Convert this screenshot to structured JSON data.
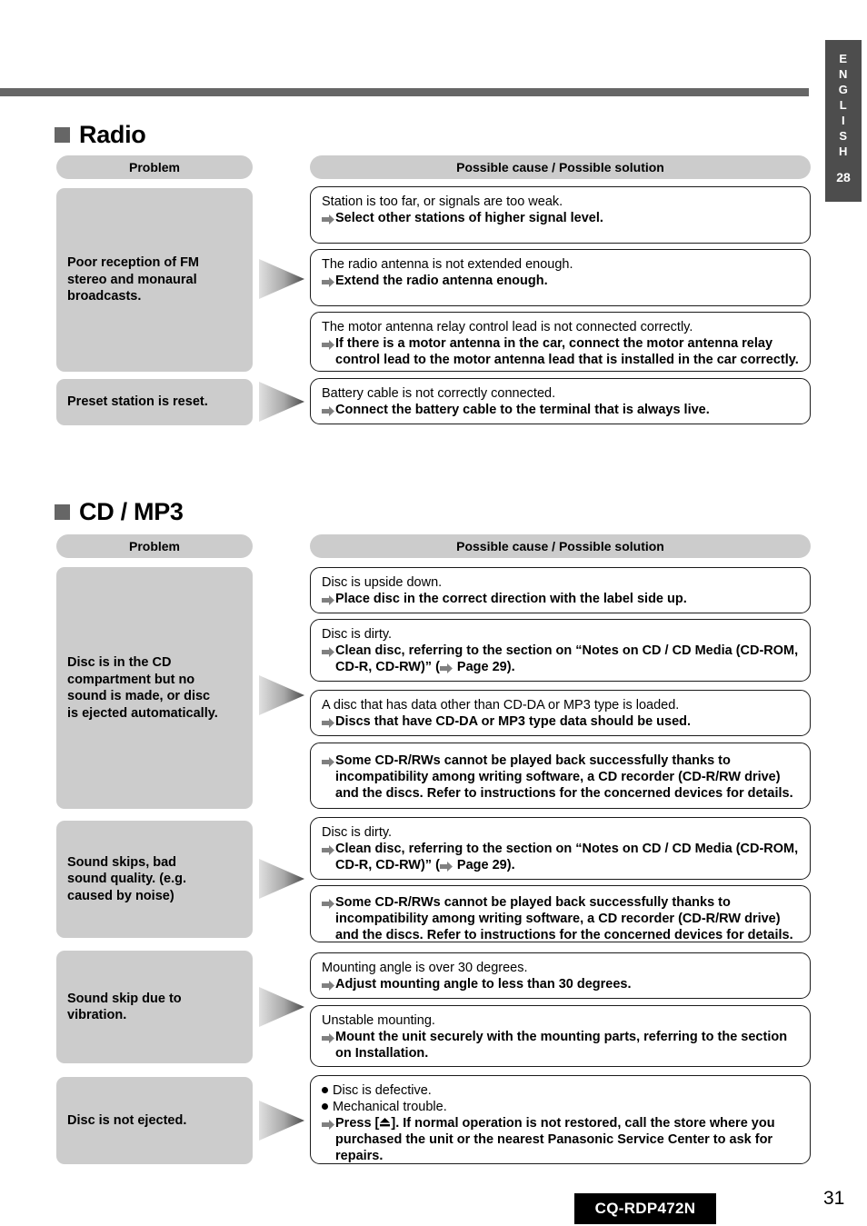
{
  "side_tab": {
    "language_letters": [
      "E",
      "N",
      "G",
      "L",
      "I",
      "S",
      "H"
    ],
    "number": "28"
  },
  "footer": {
    "model": "CQ-RDP472N",
    "page_number": "31"
  },
  "column_headers": {
    "problem": "Problem",
    "cause_solution": "Possible cause / Possible solution"
  },
  "sections": [
    {
      "title": "Radio",
      "rows": [
        {
          "problem": "Poor reception of FM stereo and monaural broadcasts.",
          "items": [
            {
              "cause": "Station is too far, or signals are too weak.",
              "solution": "Select other stations of higher signal level."
            },
            {
              "cause": "The radio antenna is not extended enough.",
              "solution": "Extend the radio antenna enough."
            },
            {
              "cause": "The motor antenna relay control lead is not connected correctly.",
              "solution": "If there is a motor antenna in the car, connect the motor antenna relay control lead to the motor antenna lead that is installed in the car correctly."
            }
          ]
        },
        {
          "problem": "Preset station is reset.",
          "items": [
            {
              "cause": "Battery cable is not correctly connected.",
              "solution": "Connect the battery cable to the terminal that is always live."
            }
          ]
        }
      ]
    },
    {
      "title": "CD / MP3",
      "rows": [
        {
          "problem": "Disc is in the CD compartment but no sound is made, or disc is ejected automatically.",
          "items": [
            {
              "cause": "Disc is upside down.",
              "solution": "Place disc in the correct direction with the label side up."
            },
            {
              "cause": "Disc is dirty.",
              "solution": "Clean disc, referring to the section on “Notes on CD / CD Media (CD-ROM, CD-R, CD-RW)” (➡ Page 29)."
            },
            {
              "cause": "A disc that has data other than CD-DA or MP3 type is loaded.",
              "solution": "Discs that have CD-DA or MP3 type data should be used."
            },
            {
              "cause": "",
              "solution": "Some CD-R/RWs cannot be played back successfully thanks to incompatibility among writing software, a CD recorder (CD-R/RW drive) and the discs. Refer to instructions for the  concerned devices for details."
            }
          ]
        },
        {
          "problem": "Sound skips, bad sound quality. (e.g. caused by noise)",
          "items": [
            {
              "cause": "Disc is dirty.",
              "solution": "Clean disc, referring to the section on “Notes on CD / CD Media (CD-ROM, CD-R, CD-RW)” (➡ Page 29)."
            },
            {
              "cause": "",
              "solution": "Some CD-R/RWs cannot be played back successfully thanks to incompatibility among writing software, a CD recorder (CD-R/RW drive) and the discs. Refer to instructions for the  concerned devices for details."
            }
          ]
        },
        {
          "problem": "Sound skip due to vibration.",
          "items": [
            {
              "cause": "Mounting angle is over 30 degrees.",
              "solution": "Adjust mounting angle to less than 30 degrees."
            },
            {
              "cause": "Unstable mounting.",
              "solution": "Mount the unit securely with the mounting parts, referring to the section on Installation."
            }
          ]
        },
        {
          "problem": "Disc is not ejected.",
          "items": [
            {
              "bullets": [
                "Disc is defective.",
                "Mechanical trouble."
              ],
              "solution": "Press [⏏].  If normal operation is not restored, call the store where you purchased the unit or the nearest Panasonic Service Center to ask for repairs."
            }
          ]
        }
      ]
    }
  ],
  "text": {
    "radio_title": "Radio",
    "cdmp3_title": "CD / MP3",
    "r1_problem_l1": "Poor reception of FM",
    "r1_problem_l2": "stereo and monaural",
    "r1_problem_l3": "broadcasts.",
    "r2_problem": "Preset station is reset.",
    "r1i1_cause": "Station is too far, or signals are too weak.",
    "r1i1_sol": "Select other stations of higher signal level.",
    "r1i2_cause": "The radio antenna is not extended enough.",
    "r1i2_sol": "Extend the radio antenna enough.",
    "r1i3_cause": "The motor antenna relay control lead is not connected correctly.",
    "r1i3_sol_l1": "If there is a motor antenna in the car, connect the motor antenna relay",
    "r1i3_sol_l2": "control lead to the motor antenna lead that is installed in the car correctly.",
    "r2i1_cause": "Battery cable is not correctly connected.",
    "r2i1_sol": "Connect the battery cable to the terminal that is always live.",
    "c1_problem_l1": "Disc is in the CD",
    "c1_problem_l2": "compartment but no",
    "c1_problem_l3": "sound is made, or disc",
    "c1_problem_l4": "is ejected automatically.",
    "c2_problem_l1": "Sound skips, bad",
    "c2_problem_l2": "sound quality. (e.g.",
    "c2_problem_l3": "caused by noise)",
    "c3_problem_l1": "Sound skip due to",
    "c3_problem_l2": "vibration.",
    "c4_problem": "Disc is not ejected.",
    "c1i1_cause": "Disc is upside down.",
    "c1i1_sol": "Place disc in the correct direction with the label side up.",
    "c1i2_cause": "Disc is dirty.",
    "c1i2_sol_l1": "Clean disc, referring to the section on “Notes on CD / CD Media (CD-ROM,",
    "c1i2_sol_l2a": "CD-R, CD-RW)” (",
    "c1i2_sol_l2b": " Page 29).",
    "c1i3_cause": "A disc that has data other than CD-DA or MP3 type is loaded.",
    "c1i3_sol": "Discs that have CD-DA or MP3 type data should be used.",
    "c1i4_sol_l1": "Some CD-R/RWs cannot be played back successfully thanks to",
    "c1i4_sol_l2": "incompatibility among writing software, a CD recorder (CD-R/RW drive)",
    "c1i4_sol_l3": "and the discs. Refer to instructions for the  concerned devices for details.",
    "c3i1_cause": "Mounting angle is over 30 degrees.",
    "c3i1_sol": "Adjust mounting angle to less than 30 degrees.",
    "c3i2_cause": "Unstable mounting.",
    "c3i2_sol_l1": "Mount the unit securely with the mounting parts, referring to the section",
    "c3i2_sol_l2": "on Installation.",
    "c4b1": "Disc is defective.",
    "c4b2": "Mechanical trouble.",
    "c4_sol_l1a": "Press [",
    "c4_sol_l1b": "].  If normal operation is not restored, call the store where you",
    "c4_sol_l2": "purchased the unit or the nearest Panasonic Service Center to ask for",
    "c4_sol_l3": "repairs."
  },
  "colors": {
    "tab_bg": "#4d4d4d",
    "pill_bg": "#cccccc",
    "rule": "#666666",
    "badge_bg": "#000000"
  }
}
